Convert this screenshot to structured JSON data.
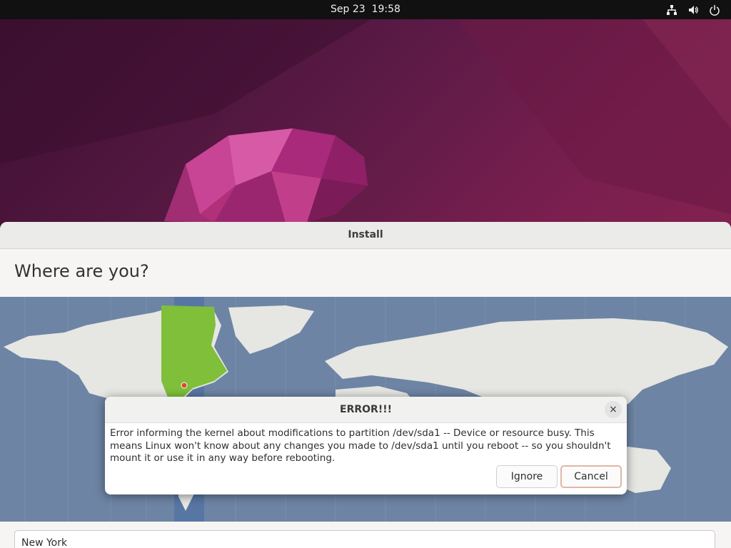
{
  "topbar": {
    "date": "Sep 23",
    "time": "19:58",
    "icons": [
      "network-icon",
      "volume-icon",
      "power-icon"
    ]
  },
  "installer": {
    "title": "Install",
    "heading": "Where are you?",
    "timezone_value": "New York"
  },
  "dialog": {
    "title": "ERROR!!!",
    "message": "Error informing the kernel about modifications to partition /dev/sda1 -- Device or resource busy. This means Linux won't know about any changes you made to /dev/sda1 until you reboot -- so you shouldn't mount it or use it in any way before rebooting.",
    "close_glyph": "×",
    "ignore_label": "Ignore",
    "cancel_label": "Cancel"
  },
  "colors": {
    "accent": "#e95420",
    "map_water": "#6d84a4",
    "map_land": "#e6e6e3",
    "selected_timezone": "#7fbf3a"
  }
}
